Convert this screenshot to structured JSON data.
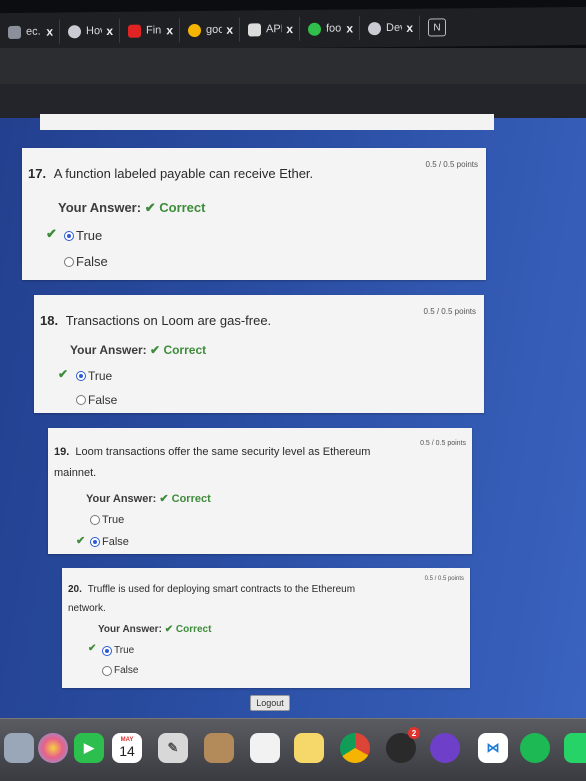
{
  "browser": {
    "tabs": [
      {
        "label": "ec.",
        "color": "#8a8f99"
      },
      {
        "label": "Hov",
        "color": "#c9cdd3"
      },
      {
        "label": "Fin",
        "color": "#e02424"
      },
      {
        "label": "goo",
        "color": "#f4b400"
      },
      {
        "label": "API",
        "color": "#dcdcdc"
      },
      {
        "label": "foo",
        "color": "#2fbf4a"
      },
      {
        "label": "Dev",
        "color": "#c9cdd3"
      }
    ],
    "close_glyph": "x"
  },
  "questions": [
    {
      "number": "17.",
      "text": "A function labeled payable can receive Ether.",
      "points": "0.5 / 0.5 points",
      "your_answer_label": "Your Answer:",
      "result": "Correct",
      "options": [
        {
          "label": "True",
          "selected": true
        },
        {
          "label": "False",
          "selected": false
        }
      ]
    },
    {
      "number": "18.",
      "text": "Transactions on Loom are gas-free.",
      "points": "0.5 / 0.5 points",
      "your_answer_label": "Your Answer:",
      "result": "Correct",
      "options": [
        {
          "label": "True",
          "selected": true
        },
        {
          "label": "False",
          "selected": false
        }
      ]
    },
    {
      "number": "19.",
      "text": "Loom transactions offer the same security level as Ethereum mainnet.",
      "points": "0.5 / 0.5 points",
      "your_answer_label": "Your Answer:",
      "result": "Correct",
      "options": [
        {
          "label": "True",
          "selected": false
        },
        {
          "label": "False",
          "selected": true
        }
      ]
    },
    {
      "number": "20.",
      "text": "Truffle is used for deploying smart contracts to the Ethereum network.",
      "points": "0.5 / 0.5 points",
      "your_answer_label": "Your Answer:",
      "result": "Correct",
      "options": [
        {
          "label": "True",
          "selected": true
        },
        {
          "label": "False",
          "selected": false
        }
      ]
    }
  ],
  "logout_label": "Logout",
  "dock": {
    "calendar_month": "MAY",
    "calendar_day": "14",
    "badge": "2"
  },
  "colors": {
    "correct": "#3e8c3a",
    "page_bg": "#2a4ea3",
    "radio": "#2c5bd6"
  }
}
